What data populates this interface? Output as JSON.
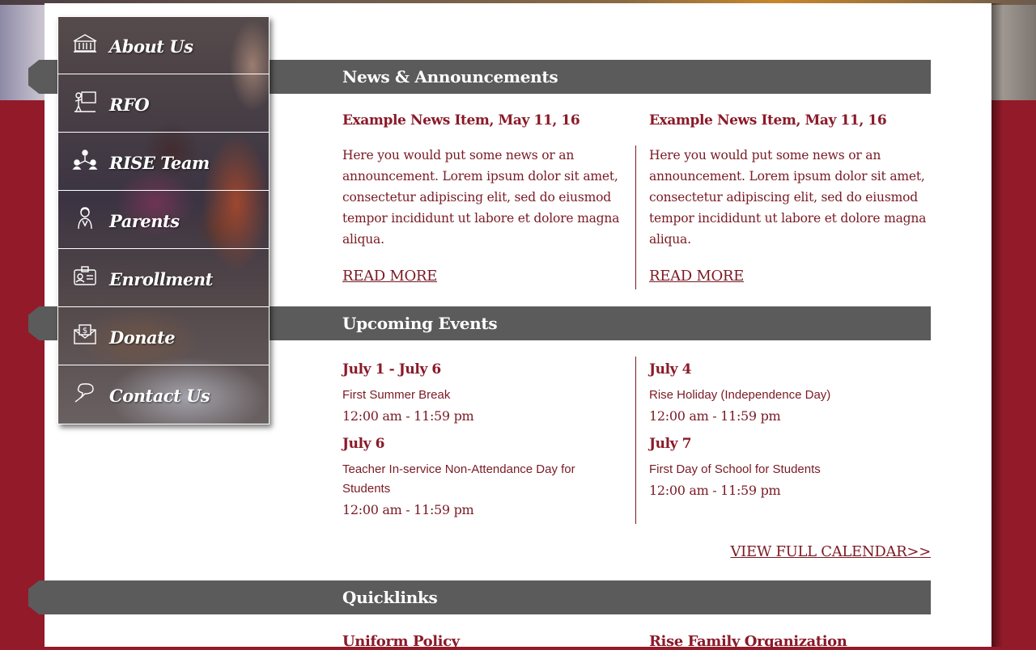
{
  "nav": {
    "items": [
      {
        "label": "About Us",
        "icon": "school-building-icon"
      },
      {
        "label": "RFO",
        "icon": "presentation-icon"
      },
      {
        "label": "RISE Team",
        "icon": "team-icon"
      },
      {
        "label": "Parents",
        "icon": "parent-icon"
      },
      {
        "label": "Enrollment",
        "icon": "id-card-icon"
      },
      {
        "label": "Donate",
        "icon": "donation-envelope-icon"
      },
      {
        "label": "Contact Us",
        "icon": "chat-bubble-icon"
      }
    ]
  },
  "news": {
    "title": "News & Announcements",
    "items": [
      {
        "title": "Example News Item, May 11, 16",
        "body": "Here you would put some news or an announcement. Lorem ipsum dolor sit amet, consectetur adipiscing elit, sed do eiusmod tempor incididunt ut labore et dolore magna aliqua.",
        "link": "READ MORE"
      },
      {
        "title": "Example News Item, May 11, 16",
        "body": "Here you would put some news or an announcement. Lorem ipsum dolor sit amet, consectetur adipiscing elit, sed do eiusmod tempor incididunt ut labore et dolore magna aliqua.",
        "link": "READ MORE"
      }
    ]
  },
  "events": {
    "title": "Upcoming Events",
    "items": [
      {
        "date": "July 1 - July 6",
        "desc": "First Summer Break",
        "time": "12:00 am - 11:59 pm"
      },
      {
        "date": "July 4",
        "desc": "Rise Holiday (Independence Day)",
        "time": "12:00 am - 11:59 pm"
      },
      {
        "date": "July 6",
        "desc": "Teacher In-service Non-Attendance Day for Students",
        "time": "12:00 am - 11:59 pm"
      },
      {
        "date": "July 7",
        "desc": "First Day of School for Students",
        "time": "12:00 am - 11:59 pm"
      }
    ],
    "calendar_link": "VIEW FULL CALENDAR>>"
  },
  "quicklinks": {
    "title": "Quicklinks",
    "items": [
      "Uniform Policy",
      "Rise Family Organization"
    ]
  },
  "colors": {
    "brand_red": "#931a28",
    "section_bar": "#5b5b5b",
    "text_red": "#7a1a24"
  }
}
